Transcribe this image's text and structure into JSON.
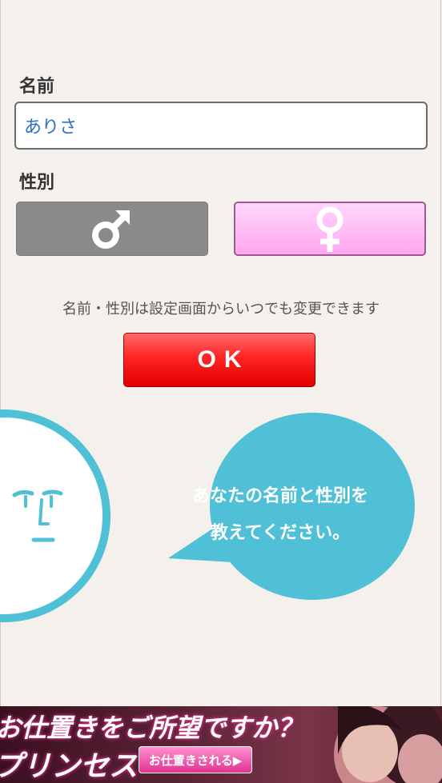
{
  "form": {
    "name_label": "名前",
    "name_value": "ありさ",
    "gender_label": "性別",
    "male_symbol": "♂",
    "female_symbol": "♀",
    "selected_gender": "female",
    "notice": "名前・性別は設定画面からいつでも変更できます",
    "ok_label": "OK"
  },
  "bubble": {
    "line1": "あなたの名前と性別を",
    "line2": "教えてください。"
  },
  "ad": {
    "headline1": "お仕置きをご所望ですか？",
    "headline2": "プリンセス",
    "cta": "お仕置きされる▶"
  },
  "colors": {
    "background": "#f4f0ec",
    "accent_blue": "#4fc0d6",
    "ok_red": "#ff2424",
    "female_pink": "#ffb8f2",
    "male_gray": "#8a8a8a",
    "input_text_blue": "#2a6fc0"
  },
  "icons": {
    "male": "male-symbol-icon",
    "female": "female-symbol-icon"
  }
}
